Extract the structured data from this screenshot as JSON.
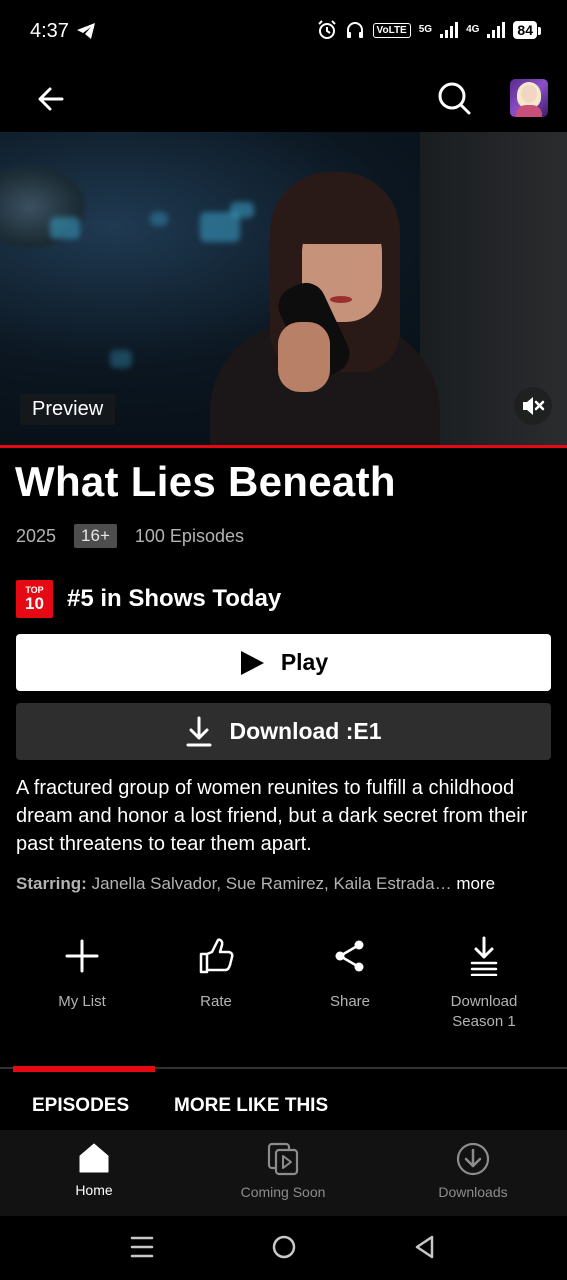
{
  "status_bar": {
    "time": "4:37",
    "volte": "VoLTE",
    "net1": "5G",
    "net2": "4G",
    "battery": "84"
  },
  "preview": {
    "label": "Preview",
    "progress_fraction": 1.0
  },
  "show": {
    "title": "What Lies Beneath",
    "year": "2025",
    "rating": "16+",
    "episodes": "100 Episodes",
    "top10_small": "TOP",
    "top10_big": "10",
    "ranking": "#5 in Shows Today"
  },
  "buttons": {
    "play": "Play",
    "download": "Download :E1"
  },
  "synopsis": "A fractured group of women reunites to fulfill a childhood dream and honor a lost friend, but a dark secret from their past threatens to tear them apart.",
  "starring": {
    "label": "Starring:",
    "names": " Janella Salvador, Sue Ramirez, Kaila Estrada…",
    "more": " more"
  },
  "actions": {
    "my_list": "My List",
    "rate": "Rate",
    "share": "Share",
    "download_season": "Download Season 1"
  },
  "tabs": {
    "episodes": "EPISODES",
    "more_like_this": "MORE LIKE THIS"
  },
  "bottom_nav": {
    "home": "Home",
    "coming_soon": "Coming Soon",
    "downloads": "Downloads"
  },
  "colors": {
    "brand_red": "#e50914",
    "background": "#000000"
  }
}
